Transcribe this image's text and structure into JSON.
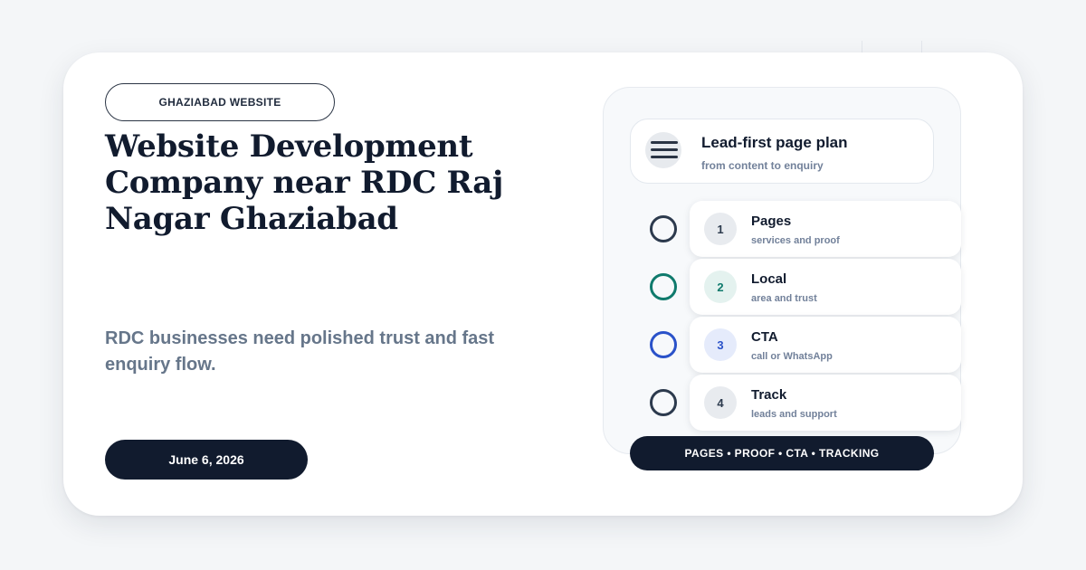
{
  "tag": "GHAZIABAD WEBSITE",
  "title": "Website Development Company near RDC Raj Nagar Ghaziabad",
  "subtitle": "RDC businesses need polished trust and fast enquiry flow.",
  "date": "June 6, 2026",
  "plan": {
    "title": "Lead-first page plan",
    "subtitle": "from content to enquiry",
    "icon": "menu-lines-icon"
  },
  "steps": [
    {
      "num": "1",
      "title": "Pages",
      "sub": "services and proof",
      "color": "#2c3a4d",
      "num_bg": "#e8ebef",
      "num_color": "#2c3a4d"
    },
    {
      "num": "2",
      "title": "Local",
      "sub": "area and trust",
      "color": "#0f7a6c",
      "num_bg": "#e4f2ef",
      "num_color": "#0f7a6c"
    },
    {
      "num": "3",
      "title": "CTA",
      "sub": "call or WhatsApp",
      "color": "#2a52c9",
      "num_bg": "#e5ebfb",
      "num_color": "#2a52c9"
    },
    {
      "num": "4",
      "title": "Track",
      "sub": "leads and support",
      "color": "#2c3a4d",
      "num_bg": "#e8ebef",
      "num_color": "#2c3a4d"
    }
  ],
  "footer": "PAGES • PROOF • CTA • TRACKING"
}
